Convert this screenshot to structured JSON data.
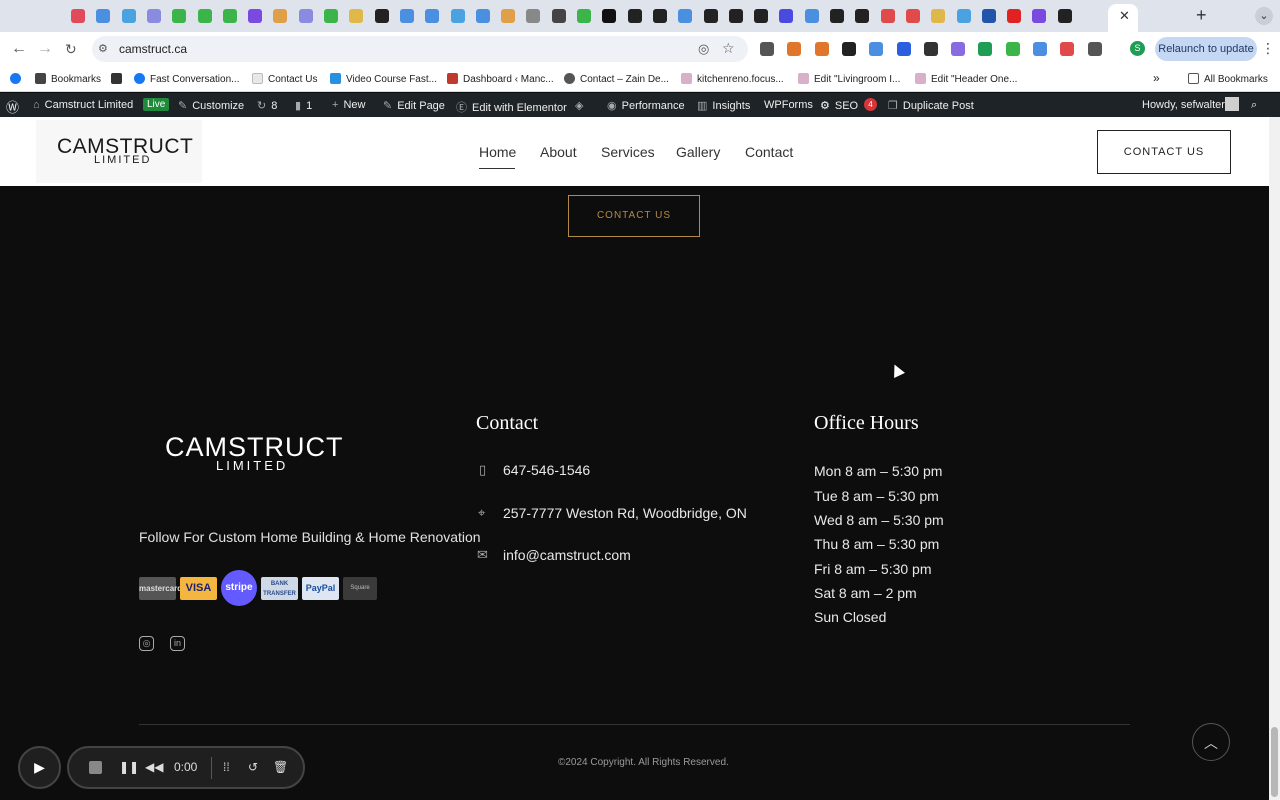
{
  "browser": {
    "url": "camstruct.ca",
    "relaunch_label": "Relaunch to update",
    "profile_initial": "S",
    "tab_colors": [
      "#e04a5a",
      "#4a8fe0",
      "#4aa3e0",
      "#8a8ae0",
      "#3bb54a",
      "#3bb54a",
      "#3bb54a",
      "#7a4ae0",
      "#e0a04a",
      "#8a8ae0",
      "#3bb54a",
      "#e0b84a",
      "#222222",
      "#4a8fe0",
      "#4a8fe0",
      "#4aa3e0",
      "#4a8fe0",
      "#e0a04a",
      "#888888",
      "#444444",
      "#3bb54a",
      "#111111",
      "#222222",
      "#222222",
      "#4a8fe0",
      "#222222",
      "#222222",
      "#222222",
      "#4a4ae0",
      "#4a8fe0",
      "#222222",
      "#222222",
      "#e04a4a",
      "#e04a4a",
      "#e0b84a",
      "#4aa3e0",
      "#2255aa",
      "#e02222",
      "#7a4ae0",
      "#222222"
    ]
  },
  "bookmarks": {
    "items": [
      {
        "label": "Bookmarks",
        "icon": "star-icon",
        "color": "#444444"
      },
      {
        "label": "",
        "icon": "cat-icon",
        "color": "#333333"
      },
      {
        "label": "Fast Conversation...",
        "icon": "facebook-icon",
        "color": "#1877f2"
      },
      {
        "label": "Contact Us",
        "icon": "page-icon",
        "color": "#e8e8e8"
      },
      {
        "label": "Video Course Fast...",
        "icon": "check-icon",
        "color": "#2b8fe0"
      },
      {
        "label": "Dashboard ‹ Manc...",
        "icon": "chart-icon",
        "color": "#c0392b"
      },
      {
        "label": "Contact – Zain De...",
        "icon": "globe-icon",
        "color": "#555555"
      },
      {
        "label": "kitchenreno.focus...",
        "icon": "page-icon",
        "color": "#d8b0c8"
      },
      {
        "label": "Edit \"Livingroom I...",
        "icon": "page-icon",
        "color": "#d8b0c8"
      },
      {
        "label": "Edit \"Header One...",
        "icon": "page-icon",
        "color": "#d8b0c8"
      }
    ],
    "all_label": "All Bookmarks"
  },
  "wpbar": {
    "site": "Camstruct Limited",
    "live": "Live",
    "customize": "Customize",
    "updates": "8",
    "comments": "1",
    "new": "New",
    "edit_page": "Edit Page",
    "elementor": "Edit with Elementor",
    "performance": "Performance",
    "insights": "Insights",
    "wpforms": "WPForms",
    "seo": "SEO",
    "seo_count": "4",
    "duplicate": "Duplicate Post",
    "howdy": "Howdy, sefwalter"
  },
  "header": {
    "logo_top": "CAMSTRUCT",
    "logo_bottom": "LIMITED",
    "nav": [
      "Home",
      "About",
      "Services",
      "Gallery",
      "Contact"
    ],
    "contact_button": "CONTACT US"
  },
  "hero": {
    "contact_button": "CONTACT US"
  },
  "footer": {
    "logo_top": "CAMSTRUCT",
    "logo_bottom": "LIMITED",
    "tagline": "Follow For Custom Home Building & Home Renovation",
    "payments": [
      "mastercard",
      "VISA",
      "stripe",
      "BANK TRANSFER",
      "PayPal",
      "Square"
    ],
    "contact_heading": "Contact",
    "phone": "647-546-1546",
    "address": "257-7777 Weston Rd, Woodbridge, ON",
    "email": "info@camstruct.com",
    "hours_heading": "Office Hours",
    "hours": [
      "Mon 8 am – 5:30 pm",
      "Tue 8 am – 5:30 pm",
      "Wed 8 am – 5:30 pm",
      "Thu 8 am – 5:30 pm",
      "Fri 8 am – 5:30 pm",
      "Sat 8 am – 2 pm",
      "Sun Closed"
    ],
    "copyright": "©2024 Copyright. All Rights Reserved."
  },
  "recorder": {
    "time": "0:00"
  }
}
